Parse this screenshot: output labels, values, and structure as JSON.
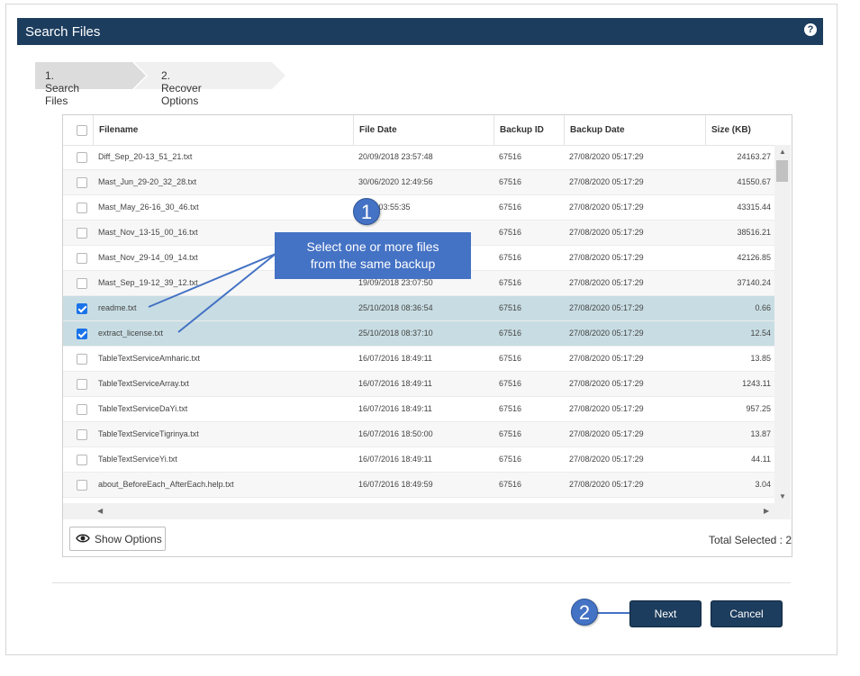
{
  "window": {
    "title": "Search Files",
    "help_icon": "help-icon"
  },
  "wizard": {
    "steps": [
      {
        "label": "1. Search Files"
      },
      {
        "label": "2. Recover Options"
      }
    ]
  },
  "table": {
    "columns": [
      "Filename",
      "File Date",
      "Backup ID",
      "Backup Date",
      "Size (KB)"
    ],
    "rows": [
      {
        "checked": false,
        "filename": "Diff_Sep_20-13_51_21.txt",
        "file_date": "20/09/2018 23:57:48",
        "backup_id": "67516",
        "backup_date": "27/08/2020 05:17:29",
        "size": "24163.27"
      },
      {
        "checked": false,
        "filename": "Mast_Jun_29-20_32_28.txt",
        "file_date": "30/06/2020 12:49:56",
        "backup_id": "67516",
        "backup_date": "27/08/2020 05:17:29",
        "size": "41550.67"
      },
      {
        "checked": false,
        "filename": "Mast_May_26-16_30_46.txt",
        "file_date": "2020 03:55:35",
        "backup_id": "67516",
        "backup_date": "27/08/2020 05:17:29",
        "size": "43315.44"
      },
      {
        "checked": false,
        "filename": "Mast_Nov_13-15_00_16.txt",
        "file_date": "",
        "backup_id": "67516",
        "backup_date": "27/08/2020 05:17:29",
        "size": "38516.21"
      },
      {
        "checked": false,
        "filename": "Mast_Nov_29-14_09_14.txt",
        "file_date": "",
        "backup_id": "67516",
        "backup_date": "27/08/2020 05:17:29",
        "size": "42126.85"
      },
      {
        "checked": false,
        "filename": "Mast_Sep_19-12_39_12.txt",
        "file_date": "19/09/2018 23:07:50",
        "backup_id": "67516",
        "backup_date": "27/08/2020 05:17:29",
        "size": "37140.24"
      },
      {
        "checked": true,
        "filename": "readme.txt",
        "file_date": "25/10/2018 08:36:54",
        "backup_id": "67516",
        "backup_date": "27/08/2020 05:17:29",
        "size": "0.66"
      },
      {
        "checked": true,
        "filename": "extract_license.txt",
        "file_date": "25/10/2018 08:37:10",
        "backup_id": "67516",
        "backup_date": "27/08/2020 05:17:29",
        "size": "12.54"
      },
      {
        "checked": false,
        "filename": "TableTextServiceAmharic.txt",
        "file_date": "16/07/2016 18:49:11",
        "backup_id": "67516",
        "backup_date": "27/08/2020 05:17:29",
        "size": "13.85"
      },
      {
        "checked": false,
        "filename": "TableTextServiceArray.txt",
        "file_date": "16/07/2016 18:49:11",
        "backup_id": "67516",
        "backup_date": "27/08/2020 05:17:29",
        "size": "1243.11"
      },
      {
        "checked": false,
        "filename": "TableTextServiceDaYi.txt",
        "file_date": "16/07/2016 18:49:11",
        "backup_id": "67516",
        "backup_date": "27/08/2020 05:17:29",
        "size": "957.25"
      },
      {
        "checked": false,
        "filename": "TableTextServiceTigrinya.txt",
        "file_date": "16/07/2016 18:50:00",
        "backup_id": "67516",
        "backup_date": "27/08/2020 05:17:29",
        "size": "13.87"
      },
      {
        "checked": false,
        "filename": "TableTextServiceYi.txt",
        "file_date": "16/07/2016 18:49:11",
        "backup_id": "67516",
        "backup_date": "27/08/2020 05:17:29",
        "size": "44.11"
      },
      {
        "checked": false,
        "filename": "about_BeforeEach_AfterEach.help.txt",
        "file_date": "16/07/2016 18:49:59",
        "backup_id": "67516",
        "backup_date": "27/08/2020 05:17:29",
        "size": "3.04"
      }
    ]
  },
  "footer": {
    "show_options_label": "Show Options",
    "total_selected": "Total Selected : 2"
  },
  "buttons": {
    "next": "Next",
    "cancel": "Cancel"
  },
  "callouts": {
    "step1": {
      "number": "1",
      "text_line1": "Select one or more files",
      "text_line2": "from the same backup"
    },
    "step2": {
      "number": "2"
    }
  },
  "colors": {
    "title_bar": "#1d3d5e",
    "selected_row": "#c8dde3",
    "callout": "#4472c4",
    "checkbox_checked": "#1a73e8"
  }
}
